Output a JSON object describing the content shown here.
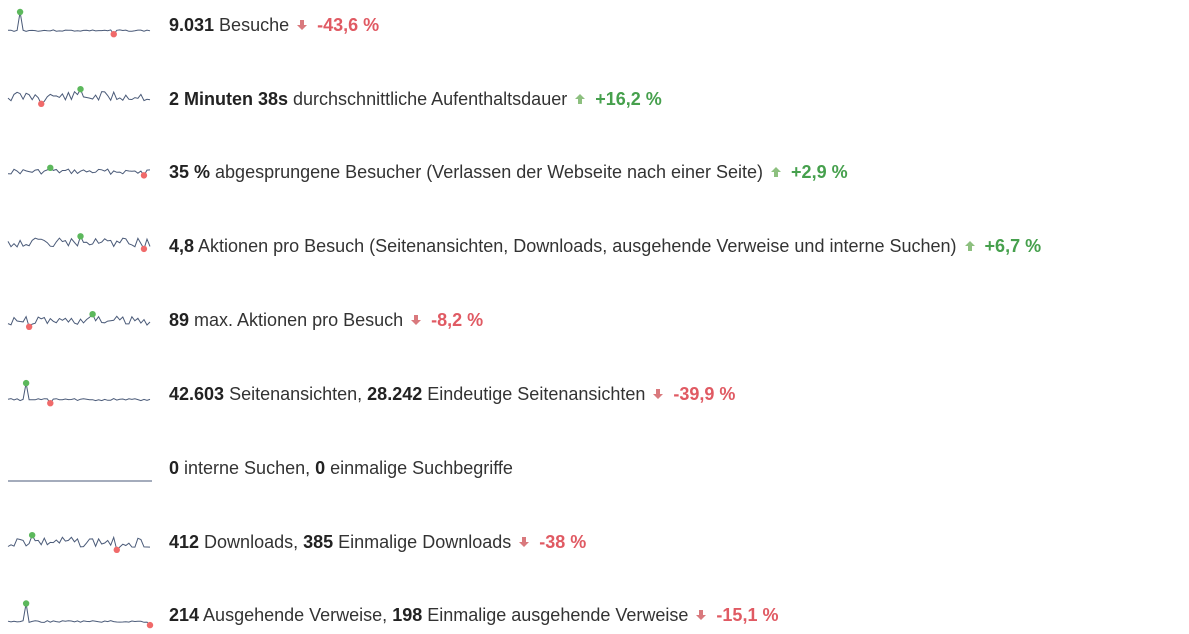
{
  "colors": {
    "negative": "#e05a63",
    "positive": "#46a04d",
    "sparkline": "#4a5a78",
    "spark_max": "#5cb85c",
    "spark_min": "#f06a6a"
  },
  "metrics": [
    {
      "icon": "sparkline-visits",
      "parts": [
        {
          "bold": true,
          "text": "9.031"
        },
        {
          "bold": false,
          "text": " Besuche"
        }
      ],
      "trend": "down",
      "change": "-43,6 %"
    },
    {
      "icon": "sparkline-avg-time",
      "parts": [
        {
          "bold": true,
          "text": "2 Minuten 38s"
        },
        {
          "bold": false,
          "text": " durchschnittliche Aufenthaltsdauer"
        }
      ],
      "trend": "up",
      "change": "+16,2 %"
    },
    {
      "icon": "sparkline-bounce",
      "parts": [
        {
          "bold": true,
          "text": "35 %"
        },
        {
          "bold": false,
          "text": " abgesprungene Besucher (Verlassen der Webseite nach einer Seite)"
        }
      ],
      "trend": "up",
      "change": "+2,9 %"
    },
    {
      "icon": "sparkline-actions",
      "parts": [
        {
          "bold": true,
          "text": "4,8"
        },
        {
          "bold": false,
          "text": " Aktionen pro Besuch (Seitenansichten, Downloads, ausgehende Verweise und interne Suchen)"
        }
      ],
      "trend": "up",
      "change": "+6,7 %"
    },
    {
      "icon": "sparkline-max-actions",
      "parts": [
        {
          "bold": true,
          "text": "89"
        },
        {
          "bold": false,
          "text": " max. Aktionen pro Besuch"
        }
      ],
      "trend": "down",
      "change": "-8,2 %"
    },
    {
      "icon": "sparkline-pageviews",
      "parts": [
        {
          "bold": true,
          "text": "42.603"
        },
        {
          "bold": false,
          "text": " Seitenansichten, "
        },
        {
          "bold": true,
          "text": "28.242"
        },
        {
          "bold": false,
          "text": " Eindeutige Seitenansichten"
        }
      ],
      "trend": "down",
      "change": "-39,9 %"
    },
    {
      "icon": "sparkline-searches",
      "parts": [
        {
          "bold": true,
          "text": "0"
        },
        {
          "bold": false,
          "text": " interne Suchen, "
        },
        {
          "bold": true,
          "text": "0"
        },
        {
          "bold": false,
          "text": " einmalige Suchbegriffe"
        }
      ],
      "trend": "none",
      "change": ""
    },
    {
      "icon": "sparkline-downloads",
      "parts": [
        {
          "bold": true,
          "text": "412"
        },
        {
          "bold": false,
          "text": " Downloads, "
        },
        {
          "bold": true,
          "text": "385"
        },
        {
          "bold": false,
          "text": " Einmalige Downloads"
        }
      ],
      "trend": "down",
      "change": "-38 %"
    },
    {
      "icon": "sparkline-outlinks",
      "parts": [
        {
          "bold": true,
          "text": "214"
        },
        {
          "bold": false,
          "text": " Ausgehende Verweise, "
        },
        {
          "bold": true,
          "text": "198"
        },
        {
          "bold": false,
          "text": " Einmalige ausgehende Verweise"
        }
      ],
      "trend": "down",
      "change": "-15,1 %"
    }
  ]
}
